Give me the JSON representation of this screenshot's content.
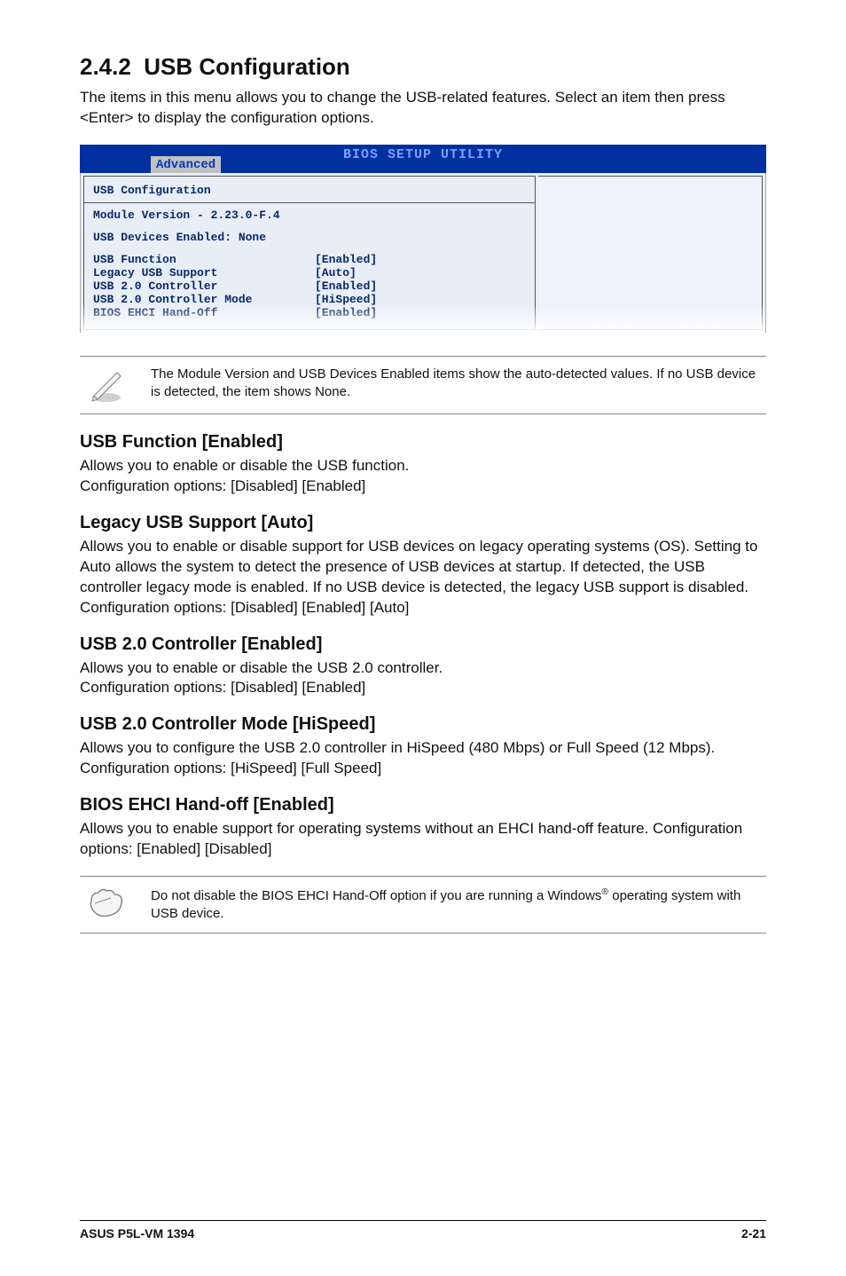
{
  "section": {
    "number": "2.4.2",
    "title": "USB Configuration",
    "intro": "The items in this menu allows you to change the USB-related features. Select an item then press <Enter> to display the configuration options."
  },
  "bios": {
    "utility_title": "BIOS SETUP UTILITY",
    "tab": "Advanced",
    "heading": "USB Configuration",
    "module_version": "Module Version - 2.23.0-F.4",
    "devices_enabled": "USB Devices Enabled: None",
    "rows": [
      {
        "label": "USB Function",
        "value": "[Enabled]"
      },
      {
        "label": "Legacy USB Support",
        "value": "[Auto]"
      },
      {
        "label": "USB 2.0 Controller",
        "value": "[Enabled]"
      },
      {
        "label": "USB 2.0 Controller Mode",
        "value": "[HiSpeed]"
      },
      {
        "label": "BIOS EHCI Hand-Off",
        "value": "[Enabled]"
      }
    ]
  },
  "note1": "The Module Version and USB Devices Enabled items show the auto-detected values. If no USB device is detected, the item shows None.",
  "subsections": [
    {
      "heading": "USB Function [Enabled]",
      "body": "Allows you to enable or disable the USB function.\nConfiguration options: [Disabled] [Enabled]"
    },
    {
      "heading": "Legacy USB Support [Auto]",
      "body": "Allows you to enable or disable support for USB devices on legacy operating systems (OS). Setting to Auto allows the system to detect the presence of USB devices at startup. If detected, the USB controller legacy mode is enabled. If no USB device is detected, the legacy USB support is disabled. Configuration options: [Disabled] [Enabled] [Auto]"
    },
    {
      "heading": "USB 2.0 Controller [Enabled]",
      "body": "Allows you to enable or disable the USB 2.0 controller.\nConfiguration options: [Disabled] [Enabled]"
    },
    {
      "heading": "USB 2.0 Controller Mode [HiSpeed]",
      "body": "Allows you to configure the USB 2.0 controller in HiSpeed (480 Mbps) or Full Speed (12 Mbps). Configuration options: [HiSpeed] [Full Speed]"
    },
    {
      "heading": "BIOS EHCI Hand-off [Enabled]",
      "body": "Allows you to enable support for operating systems without an EHCI hand-off feature. Configuration options: [Enabled] [Disabled]"
    }
  ],
  "note2_pre": "Do not disable the BIOS EHCI Hand-Off option if you are running a Windows",
  "note2_post": " operating system with USB device.",
  "footer": {
    "left": "ASUS P5L-VM 1394",
    "right": "2-21"
  }
}
